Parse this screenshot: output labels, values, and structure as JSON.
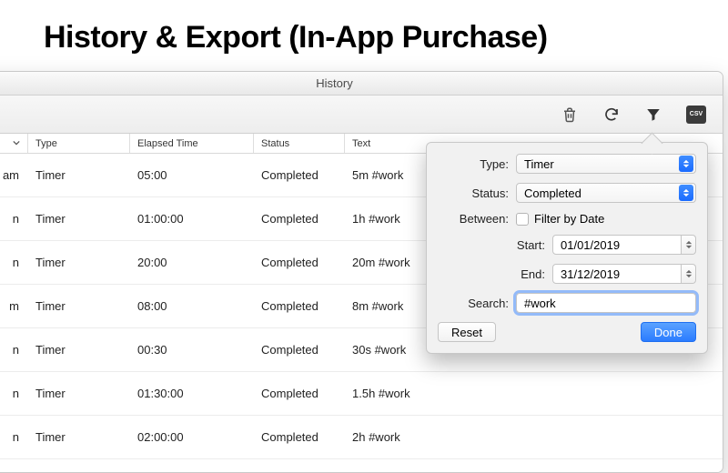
{
  "headline": "History & Export (In-App Purchase)",
  "window": {
    "title": "History"
  },
  "toolbar": {
    "csv_label": "CSV"
  },
  "columns": {
    "date": "",
    "type": "Type",
    "elapsed": "Elapsed Time",
    "status": "Status",
    "text": "Text"
  },
  "rows": [
    {
      "date": "am",
      "type": "Timer",
      "elapsed": "05:00",
      "status": "Completed",
      "text": "5m #work"
    },
    {
      "date": "n",
      "type": "Timer",
      "elapsed": "01:00:00",
      "status": "Completed",
      "text": "1h #work"
    },
    {
      "date": "n",
      "type": "Timer",
      "elapsed": "20:00",
      "status": "Completed",
      "text": "20m #work"
    },
    {
      "date": "m",
      "type": "Timer",
      "elapsed": "08:00",
      "status": "Completed",
      "text": "8m #work"
    },
    {
      "date": "n",
      "type": "Timer",
      "elapsed": "00:30",
      "status": "Completed",
      "text": "30s #work"
    },
    {
      "date": "n",
      "type": "Timer",
      "elapsed": "01:30:00",
      "status": "Completed",
      "text": "1.5h #work"
    },
    {
      "date": "n",
      "type": "Timer",
      "elapsed": "02:00:00",
      "status": "Completed",
      "text": "2h #work"
    }
  ],
  "filter": {
    "labels": {
      "type": "Type:",
      "status": "Status:",
      "between": "Between:",
      "start": "Start:",
      "end": "End:",
      "search": "Search:"
    },
    "type_value": "Timer",
    "status_value": "Completed",
    "filter_by_date_label": "Filter by Date",
    "start_value": "01/01/2019",
    "end_value": "31/12/2019",
    "search_value": "#work",
    "reset": "Reset",
    "done": "Done"
  }
}
